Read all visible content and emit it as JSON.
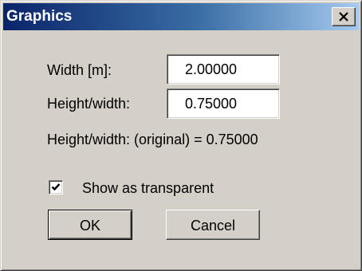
{
  "window": {
    "title": "Graphics"
  },
  "fields": {
    "width_label": "Width [m]:",
    "width_value": "2.00000",
    "height_label": "Height/width:",
    "height_value": "0.75000"
  },
  "info": {
    "original_ratio": "Height/width: (original) = 0.75000"
  },
  "options": {
    "transparent_label": "Show as transparent",
    "transparent_checked": true
  },
  "buttons": {
    "ok_label": "OK",
    "cancel_label": "Cancel"
  },
  "colors": {
    "titlebar_start": "#0a246a",
    "titlebar_end": "#a6caf0",
    "dialog_face": "#d4d0c8"
  },
  "icons": {
    "close": "close-icon",
    "check": "checkmark-icon"
  }
}
